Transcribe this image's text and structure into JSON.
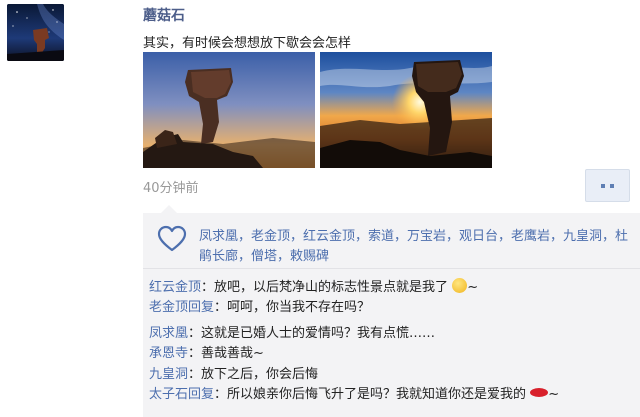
{
  "post": {
    "username": "蘑菇石",
    "text": "其实，有时候会想想放下歇会会怎样",
    "time": "40分钟前"
  },
  "likes": {
    "icon": "heart-icon",
    "names": "凤求凰，老金顶，红云金顶，索道，万宝岩，观日台，老鹰岩，九皇洞，杜鹃长廊，僧塔，敕赐碑"
  },
  "comments": [
    {
      "who": "红云金顶",
      "sep": "：",
      "text": "放吧，以后梵净山的标志性景点就是我了",
      "emoji": "grin-emoji",
      "tail": "~"
    },
    {
      "who": "老金顶回复",
      "sep": "：",
      "text": "呵呵，你当我不存在吗？"
    },
    {
      "who": "凤求凰",
      "sep": "：",
      "text": "这就是已婚人士的爱情吗？我有点慌……"
    },
    {
      "who": "承恩寺",
      "sep": "：",
      "text": "善哉善哉~"
    },
    {
      "who": "九皇洞",
      "sep": "：",
      "text": "放下之后，你会后悔"
    },
    {
      "who": "太子石回复",
      "sep": "：",
      "text": "所以娘亲你后悔飞升了是吗？我就知道你还是爱我的",
      "emoji": "lips-emoji",
      "tail": "~"
    }
  ],
  "colors": {
    "name_blue": "#4d6fae",
    "username_blue": "#4d5e8a",
    "panel_bg": "#f3f3f5"
  }
}
